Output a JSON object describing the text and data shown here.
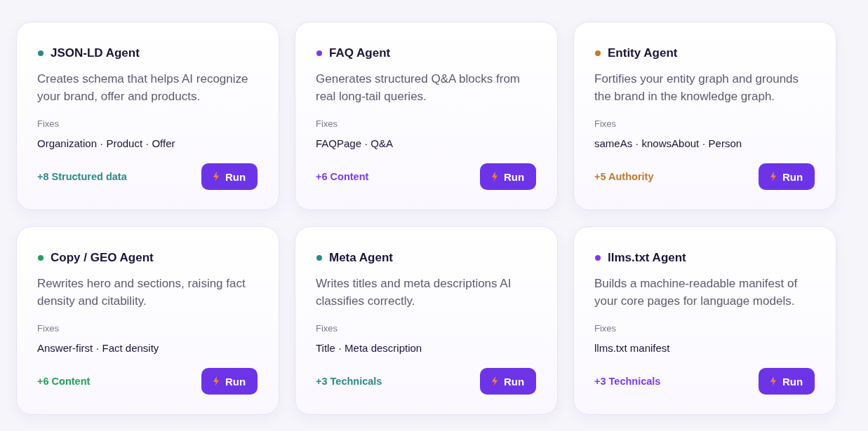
{
  "agents": [
    {
      "title": "JSON-LD Agent",
      "color": "#2a8a8a",
      "description": "Creates schema that helps AI recognize your brand, offer and products.",
      "fixes_label": "Fixes",
      "fixes": "Organization · Product · Offer",
      "impact": "+8 Structured data",
      "button": "Run"
    },
    {
      "title": "FAQ Agent",
      "color": "#7c3aed",
      "description": "Generates structured Q&A blocks from real long-tail queries.",
      "fixes_label": "Fixes",
      "fixes": "FAQPage · Q&A",
      "impact": "+6 Content",
      "button": "Run"
    },
    {
      "title": "Entity Agent",
      "color": "#c27a2a",
      "description": "Fortifies your entity graph and grounds the brand in the knowledge graph.",
      "fixes_label": "Fixes",
      "fixes": "sameAs · knowsAbout · Person",
      "impact": "+5 Authority",
      "button": "Run"
    },
    {
      "title": "Copy / GEO Agent",
      "color": "#22a05a",
      "description": "Rewrites hero and sections, raising fact density and citability.",
      "fixes_label": "Fixes",
      "fixes": "Answer-first · Fact density",
      "impact": "+6 Content",
      "button": "Run"
    },
    {
      "title": "Meta Agent",
      "color": "#2a8a8a",
      "description": "Writes titles and meta descriptions AI classifies correctly.",
      "fixes_label": "Fixes",
      "fixes": "Title · Meta description",
      "impact": "+3 Technicals",
      "button": "Run"
    },
    {
      "title": "llms.txt Agent",
      "color": "#7c3aed",
      "description": "Builds a machine-readable manifest of your core pages for language models.",
      "fixes_label": "Fixes",
      "fixes": "llms.txt manifest",
      "impact": "+3 Technicals",
      "button": "Run"
    }
  ]
}
